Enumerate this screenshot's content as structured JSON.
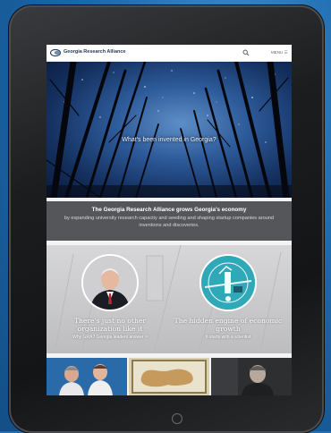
{
  "header": {
    "logo_text": "Georgia Research Alliance",
    "menu_label": "MENU"
  },
  "hero": {
    "caption": "What's been invented in Georgia?"
  },
  "banner": {
    "title": "The Georgia Research Alliance grows Georgia's economy",
    "body": "by expanding university research capacity and seeding and shaping startup companies around inventions and discoveries."
  },
  "features": [
    {
      "title": "There's just no other organization like it",
      "subtitle": "Why GRA? Georgia leaders answer >"
    },
    {
      "title": "The hidden engine of economic growth",
      "subtitle": "It starts with a scientist"
    }
  ],
  "colors": {
    "page_background": "#1f6fb2",
    "tablet_bezel": "#1c1d1f",
    "banner_background": "#555659",
    "feature_background": "#c9c9cb",
    "accent_teal": "#2fa8b8"
  },
  "icons": {
    "search": "search-icon",
    "menu": "menu-icon",
    "home": "home-button-icon"
  }
}
